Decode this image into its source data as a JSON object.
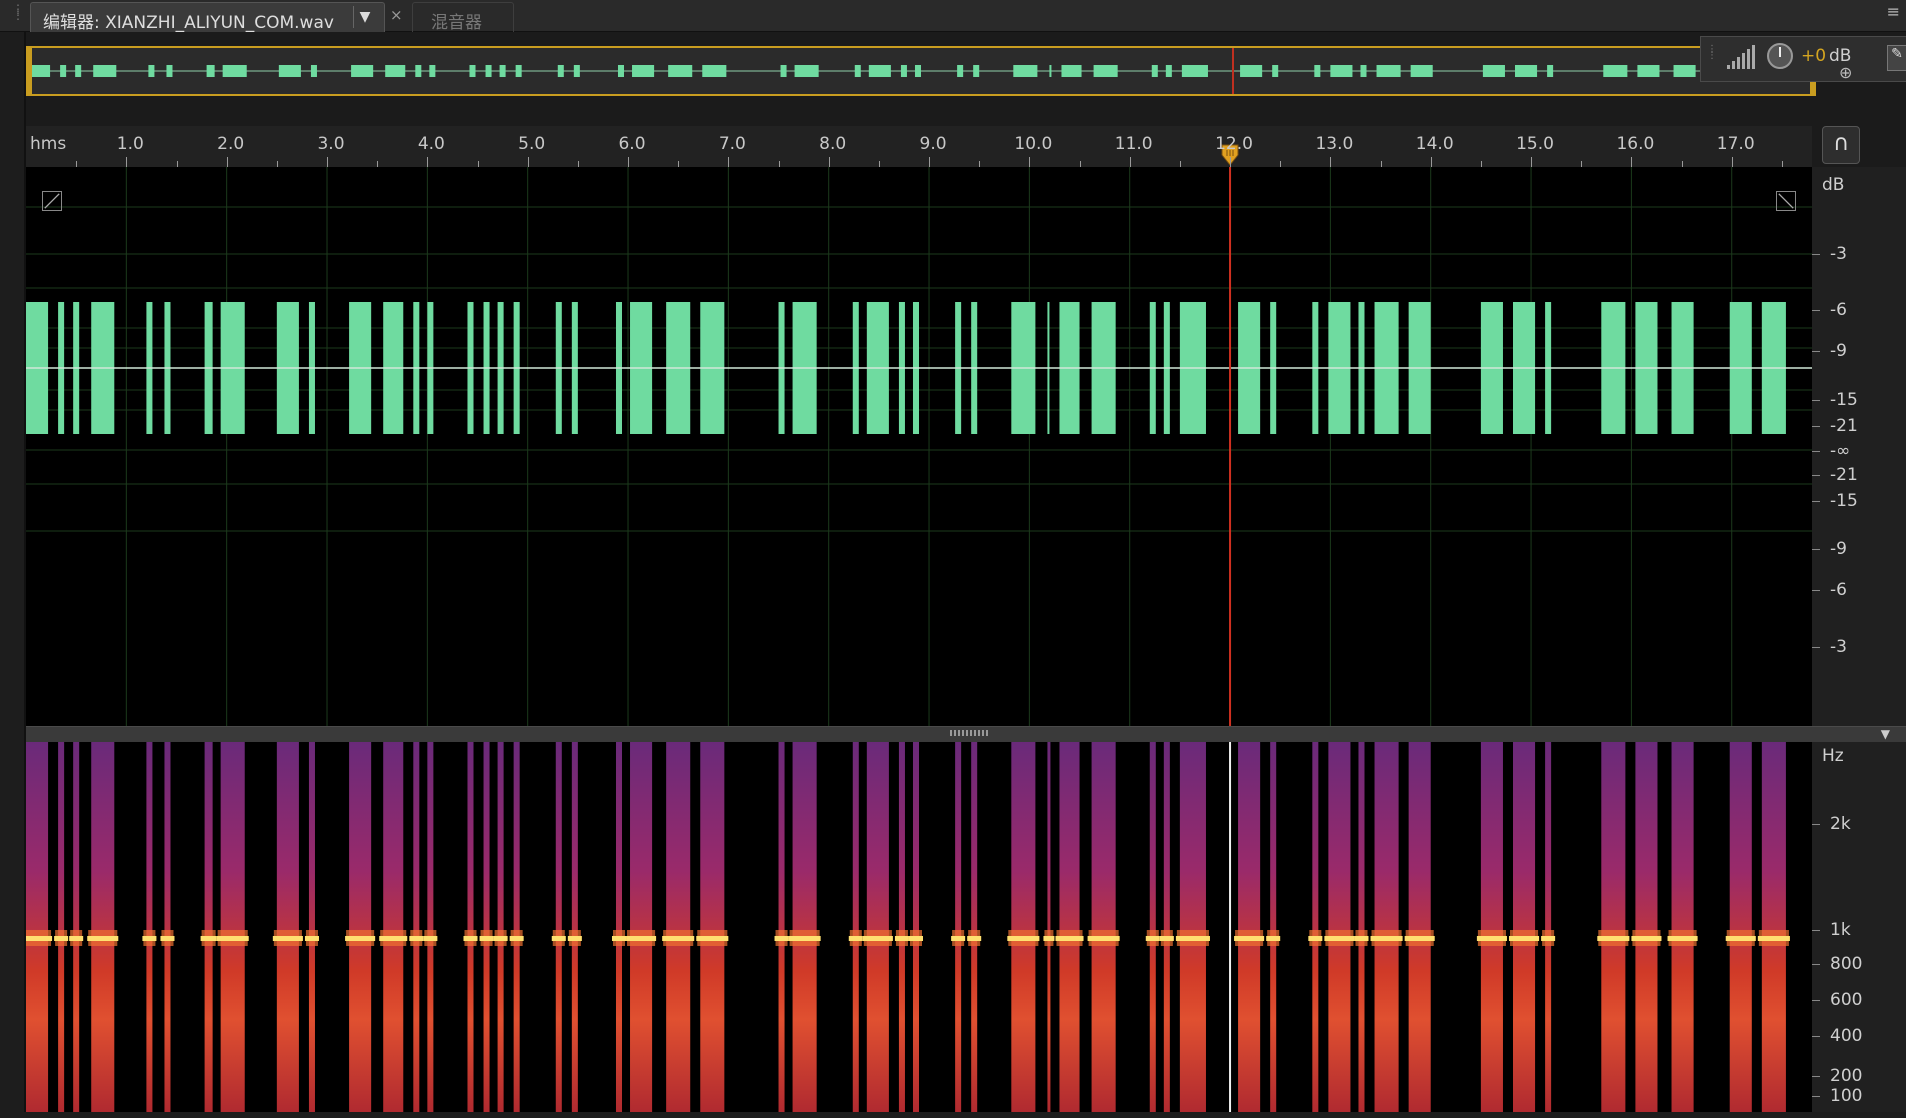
{
  "tabs": {
    "editor_label": "编辑器: XIANZHI_ALIYUN_COM.wav",
    "dropdown_glyph": "▼",
    "close_glyph": "×",
    "mixer_label": "混音器",
    "panel_menu_glyph": "≡"
  },
  "hud": {
    "gain_value": "+0",
    "gain_unit": "dB",
    "zoom_glyph": "⊕",
    "pin_glyph": "✎"
  },
  "ruler": {
    "unit_label": "hms",
    "labels": [
      "1.0",
      "2.0",
      "3.0",
      "4.0",
      "5.0",
      "6.0",
      "7.0",
      "8.0",
      "9.0",
      "10.0",
      "11.0",
      "12.0",
      "13.0",
      "14.0",
      "15.0",
      "16.0",
      "17.0"
    ],
    "view_start_sec": 0.0,
    "view_end_sec": 17.8,
    "playhead_sec": 12.0
  },
  "amplitude_scale": {
    "unit": "dB",
    "labels": [
      "-3",
      "-6",
      "-9",
      "-15",
      "-21",
      "-∞",
      "-21",
      "-15",
      "-9",
      "-6",
      "-3"
    ]
  },
  "frequency_scale": {
    "unit": "Hz",
    "labels": [
      "2k",
      "1k",
      "800",
      "600",
      "400",
      "200",
      "100"
    ]
  },
  "signal": {
    "tone_hz": 1000,
    "colors": {
      "waveform": "#6fdba0",
      "center_line": "#d0e8d8",
      "grid": "#1c3a1c",
      "playhead": "#d03020",
      "selection": "#c99d20",
      "tone_core": "#ffe070",
      "spectral_hot": "#d03a28",
      "spectral_cool": "#6a2a7a"
    },
    "pulses_sec": [
      [
        0.0,
        0.22
      ],
      [
        0.32,
        0.38
      ],
      [
        0.47,
        0.53
      ],
      [
        0.65,
        0.88
      ],
      [
        1.2,
        1.26
      ],
      [
        1.38,
        1.44
      ],
      [
        1.78,
        1.86
      ],
      [
        1.94,
        2.18
      ],
      [
        2.5,
        2.72
      ],
      [
        2.82,
        2.88
      ],
      [
        3.22,
        3.44
      ],
      [
        3.56,
        3.76
      ],
      [
        3.86,
        3.92
      ],
      [
        4.0,
        4.06
      ],
      [
        4.4,
        4.46
      ],
      [
        4.56,
        4.62
      ],
      [
        4.7,
        4.76
      ],
      [
        4.86,
        4.92
      ],
      [
        5.28,
        5.34
      ],
      [
        5.44,
        5.5
      ],
      [
        5.88,
        5.94
      ],
      [
        6.02,
        6.24
      ],
      [
        6.38,
        6.62
      ],
      [
        6.72,
        6.96
      ],
      [
        7.5,
        7.56
      ],
      [
        7.64,
        7.88
      ],
      [
        8.24,
        8.3
      ],
      [
        8.38,
        8.6
      ],
      [
        8.7,
        8.76
      ],
      [
        8.84,
        8.9
      ],
      [
        9.26,
        9.32
      ],
      [
        9.42,
        9.48
      ],
      [
        9.82,
        10.06
      ],
      [
        10.18,
        10.2
      ],
      [
        10.3,
        10.5
      ],
      [
        10.62,
        10.86
      ],
      [
        11.2,
        11.26
      ],
      [
        11.34,
        11.4
      ],
      [
        11.5,
        11.76
      ],
      [
        12.08,
        12.3
      ],
      [
        12.4,
        12.46
      ],
      [
        12.82,
        12.88
      ],
      [
        12.98,
        13.2
      ],
      [
        13.28,
        13.34
      ],
      [
        13.44,
        13.68
      ],
      [
        13.78,
        14.0
      ],
      [
        14.5,
        14.72
      ],
      [
        14.82,
        15.04
      ],
      [
        15.14,
        15.2
      ],
      [
        15.7,
        15.94
      ],
      [
        16.04,
        16.26
      ],
      [
        16.4,
        16.62
      ],
      [
        16.98,
        17.2
      ],
      [
        17.3,
        17.54
      ]
    ]
  }
}
